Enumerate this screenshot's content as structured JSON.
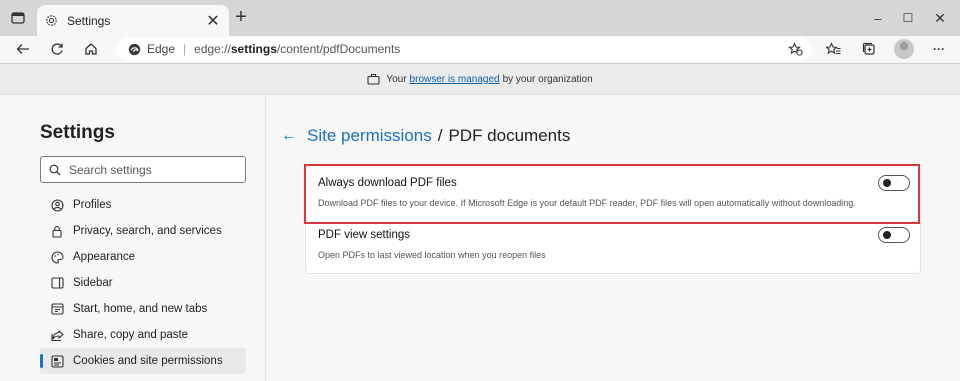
{
  "tab": {
    "title": "Settings",
    "close_glyph": "✕"
  },
  "newtab_glyph": "+",
  "window": {
    "minimize": "–",
    "maximize": "☐",
    "close": "✕"
  },
  "address": {
    "site_label": "Edge",
    "separator": "|",
    "url_proto": "edge://",
    "url_host": "settings",
    "url_path": "/content/pdfDocuments"
  },
  "toolbar": {
    "more_glyph": "···"
  },
  "banner": {
    "prefix": "Your",
    "link": "browser is managed",
    "suffix": "by your organization"
  },
  "sidebar": {
    "title": "Settings",
    "search_placeholder": "Search settings",
    "items": [
      {
        "label": "Profiles",
        "icon": "profile-icon"
      },
      {
        "label": "Privacy, search, and services",
        "icon": "lock-icon"
      },
      {
        "label": "Appearance",
        "icon": "palette-icon"
      },
      {
        "label": "Sidebar",
        "icon": "sidebar-icon"
      },
      {
        "label": "Start, home, and new tabs",
        "icon": "start-icon"
      },
      {
        "label": "Share, copy and paste",
        "icon": "share-icon"
      },
      {
        "label": "Cookies and site permissions",
        "icon": "cookies-icon",
        "active": true
      }
    ]
  },
  "main": {
    "back_glyph": "←",
    "parent": "Site permissions",
    "slash": "/",
    "current": "PDF documents",
    "rows": [
      {
        "label": "Always download PDF files",
        "desc": "Download PDF files to your device. If Microsoft Edge is your default PDF reader, PDF files will open automatically without downloading.",
        "toggle_on": false
      },
      {
        "label": "PDF view settings",
        "desc": "Open PDFs to last viewed location when you reopen files",
        "toggle_on": false
      }
    ]
  },
  "colors": {
    "accent": "#1d6fc2",
    "highlight": "#d8353d"
  }
}
